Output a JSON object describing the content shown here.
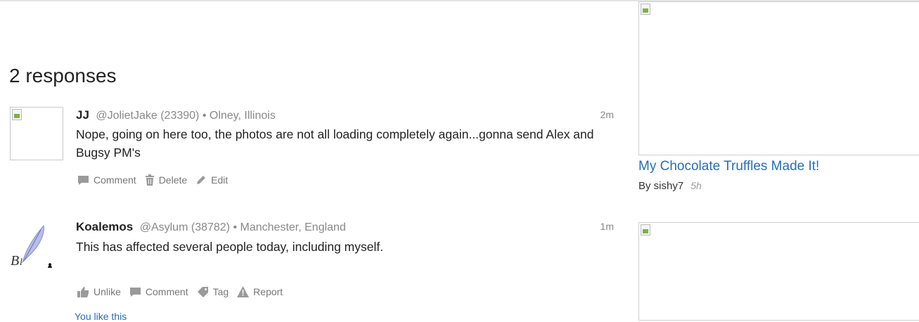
{
  "heading": "2 responses",
  "responses": [
    {
      "name": "JJ",
      "handle": "@JolietJake",
      "points": "(23390)",
      "location": "Olney, Illinois",
      "time": "2m",
      "text": "Nope, going on here too, the photos are not all loading completely again...gonna send Alex and Bugsy PM's",
      "actions": [
        "Comment",
        "Delete",
        "Edit"
      ]
    },
    {
      "name": "Koalemos",
      "handle": "@Asylum",
      "points": "(38782)",
      "location": "Manchester, England",
      "time": "1m",
      "text": "This has affected several people today, including myself.",
      "actions": [
        "Unlike",
        "Comment",
        "Tag",
        "Report"
      ],
      "likes_text": "You like this"
    }
  ],
  "sidebar": {
    "items": [
      {
        "title": "My Chocolate Truffles Made It!",
        "by": "By sishy7",
        "age": "5h"
      }
    ]
  },
  "colors": {
    "link": "#2b6cb3",
    "muted": "#888888",
    "icon": "#9a9a9a"
  }
}
